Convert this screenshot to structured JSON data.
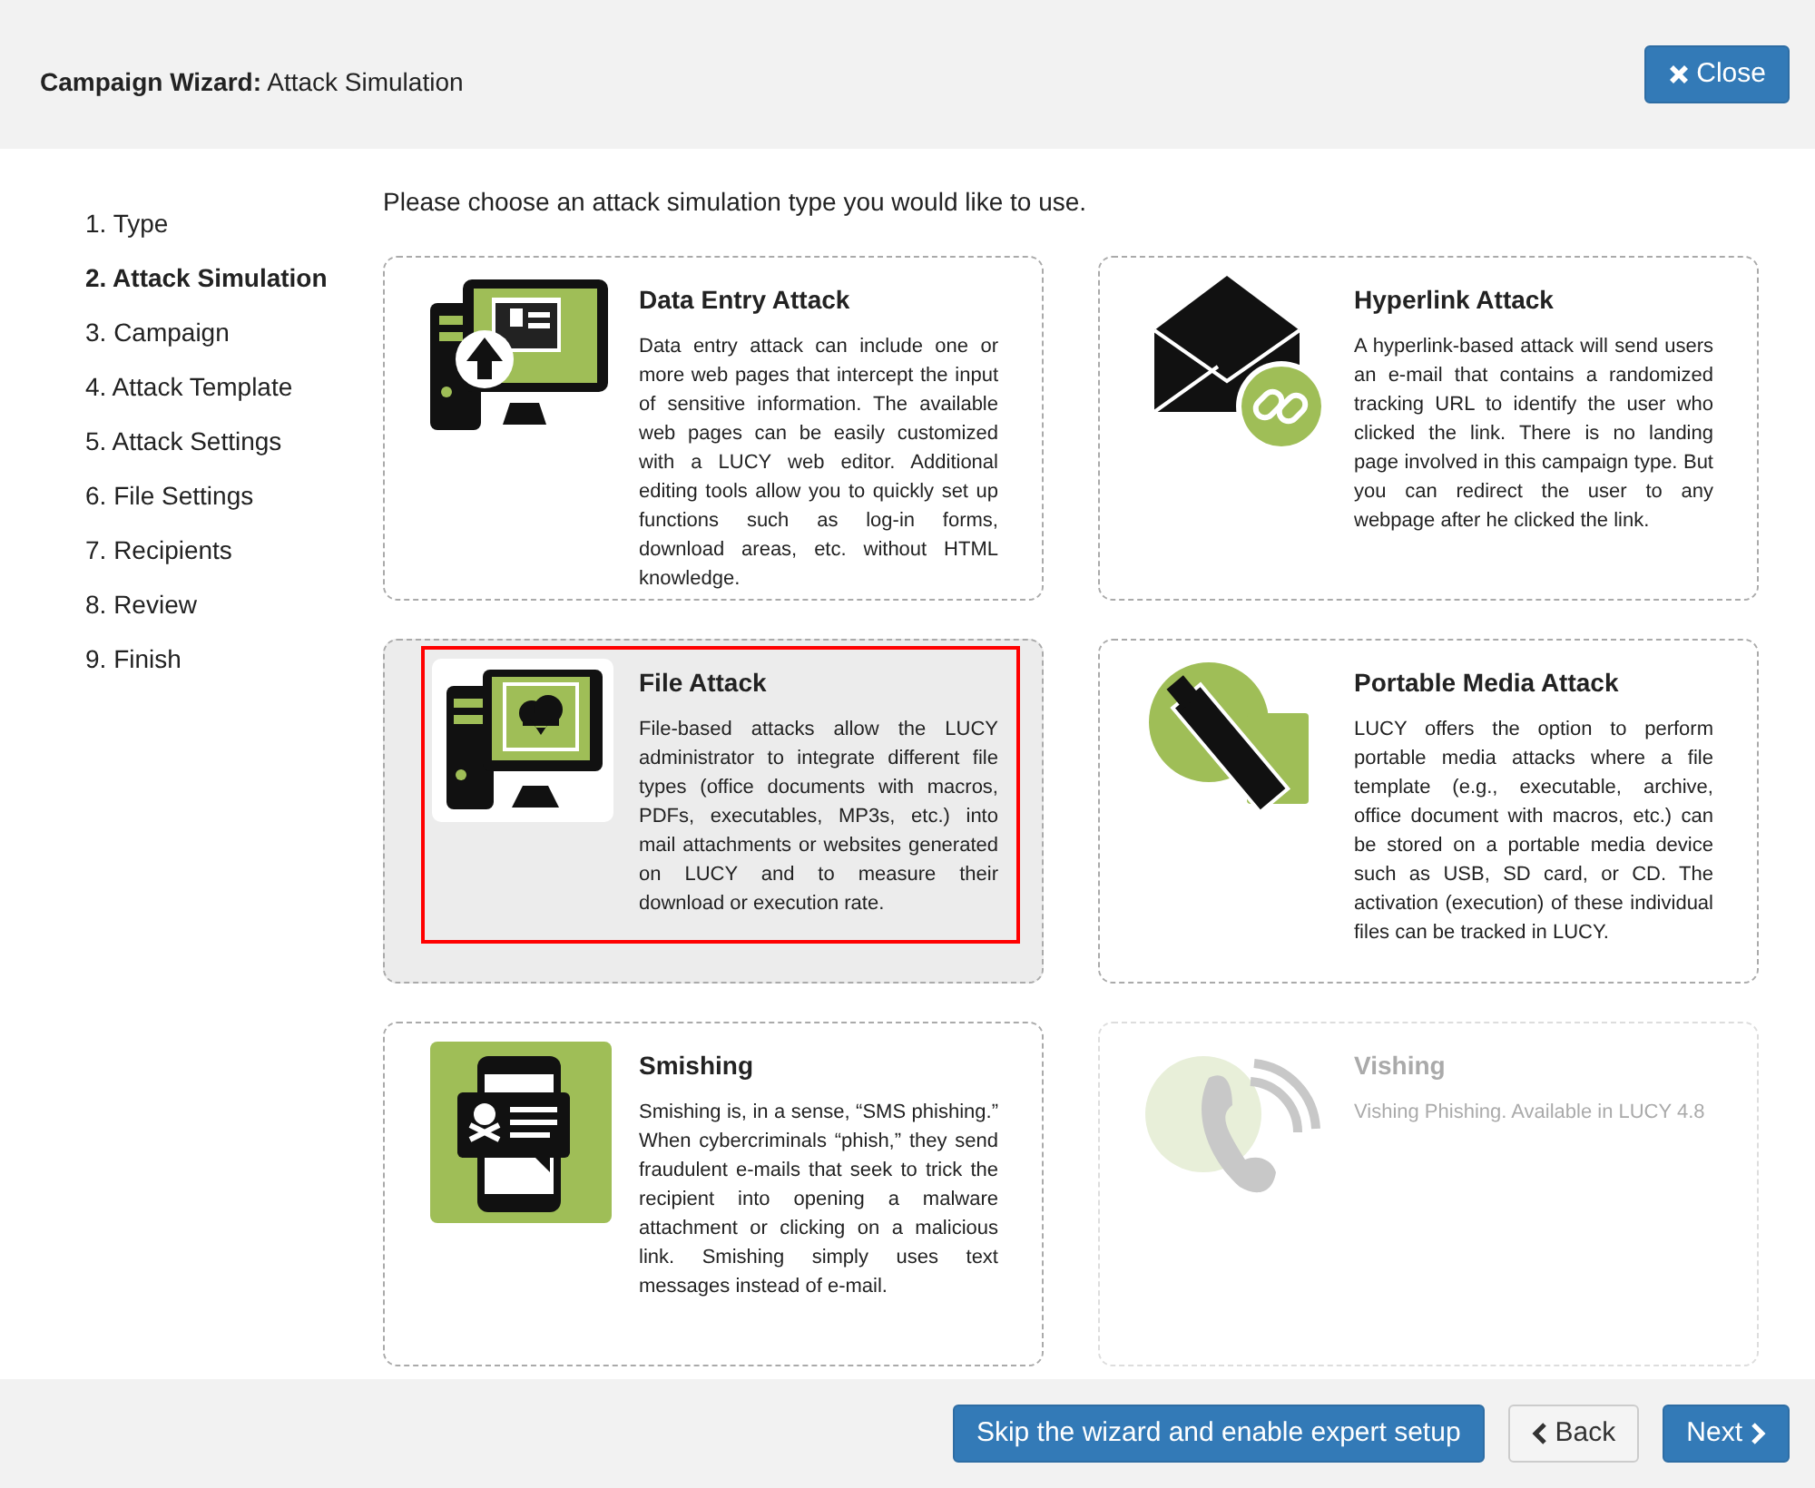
{
  "header": {
    "title_bold": "Campaign Wizard:",
    "title": "Attack Simulation",
    "close_button": "Close"
  },
  "steps": [
    {
      "label": "1. Type",
      "selected": false
    },
    {
      "label": "2. Attack Simulation",
      "selected": true
    },
    {
      "label": "3. Campaign",
      "selected": false
    },
    {
      "label": "4. Attack Template",
      "selected": false
    },
    {
      "label": "5. Attack Settings",
      "selected": false
    },
    {
      "label": "6. File Settings",
      "selected": false
    },
    {
      "label": "7. Recipients",
      "selected": false
    },
    {
      "label": "8. Review",
      "selected": false
    },
    {
      "label": "9. Finish",
      "selected": false
    }
  ],
  "prompt": "Please choose an attack simulation type you would like to use.",
  "cards": [
    {
      "title": "Data Entry Attack",
      "text": "Data entry attack can include one or more web pages that intercept the input of sensitive information. The available web pages can be easily customized with a LUCY web editor. Additional editing tools allow you to quickly set up functions such as log-in forms, download areas, etc. without HTML knowledge.",
      "selected": false,
      "disabled": false
    },
    {
      "title": "Hyperlink Attack",
      "text": "A hyperlink-based attack will send users an e-mail that contains a randomized tracking URL to identify the user who clicked the link. There is no landing page involved in this campaign type. But you can redirect the user to any webpage after he clicked the link.",
      "selected": false,
      "disabled": false
    },
    {
      "title": "File Attack",
      "text": "File-based attacks allow the LUCY administrator to integrate different file types (office documents with macros, PDFs, executables, MP3s, etc.) into mail attachments or websites generated on LUCY and to measure their download or execution rate.",
      "selected": true,
      "disabled": false
    },
    {
      "title": "Portable Media Attack",
      "text": "LUCY offers the option to perform portable media attacks where a file template (e.g., executable, archive, office document with macros, etc.) can be stored on a portable media device such as USB, SD card, or CD. The activation (execution) of these individual files can be tracked in LUCY.",
      "selected": false,
      "disabled": false
    },
    {
      "title": "Smishing",
      "text": "Smishing is, in a sense, “SMS phishing.” When cybercriminals “phish,” they send fraudulent e-mails that seek to trick the recipient into opening a malware attachment or clicking on a malicious link. Smishing simply uses text messages instead of e-mail.",
      "selected": false,
      "disabled": false
    },
    {
      "title": "Vishing",
      "text": "Vishing Phishing. Available in LUCY 4.8",
      "selected": false,
      "disabled": true
    }
  ],
  "footer": {
    "skip_button": "Skip the wizard and enable expert setup",
    "back_button": "Back",
    "next_button": "Next"
  }
}
